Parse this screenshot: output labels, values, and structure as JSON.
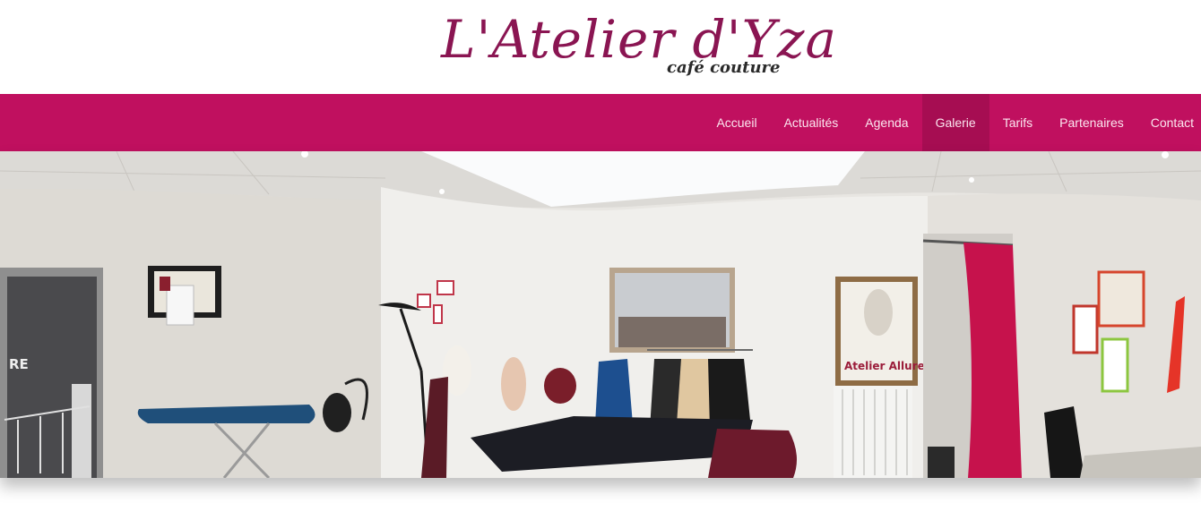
{
  "logo": {
    "title": "L'Atelier d'Yza",
    "subtitle": "café couture"
  },
  "nav": {
    "items": [
      {
        "label": "Accueil"
      },
      {
        "label": "Actualités"
      },
      {
        "label": "Agenda"
      },
      {
        "label": "Galerie"
      },
      {
        "label": "Tarifs"
      },
      {
        "label": "Partenaires"
      },
      {
        "label": "Contact"
      }
    ],
    "active": "Galerie"
  },
  "banner": {
    "poster_text": "Atelier Allure",
    "sign_text": "RE"
  },
  "colors": {
    "brand": "#c0105f",
    "brand_active": "#a60d52",
    "logo": "#8a1552"
  }
}
